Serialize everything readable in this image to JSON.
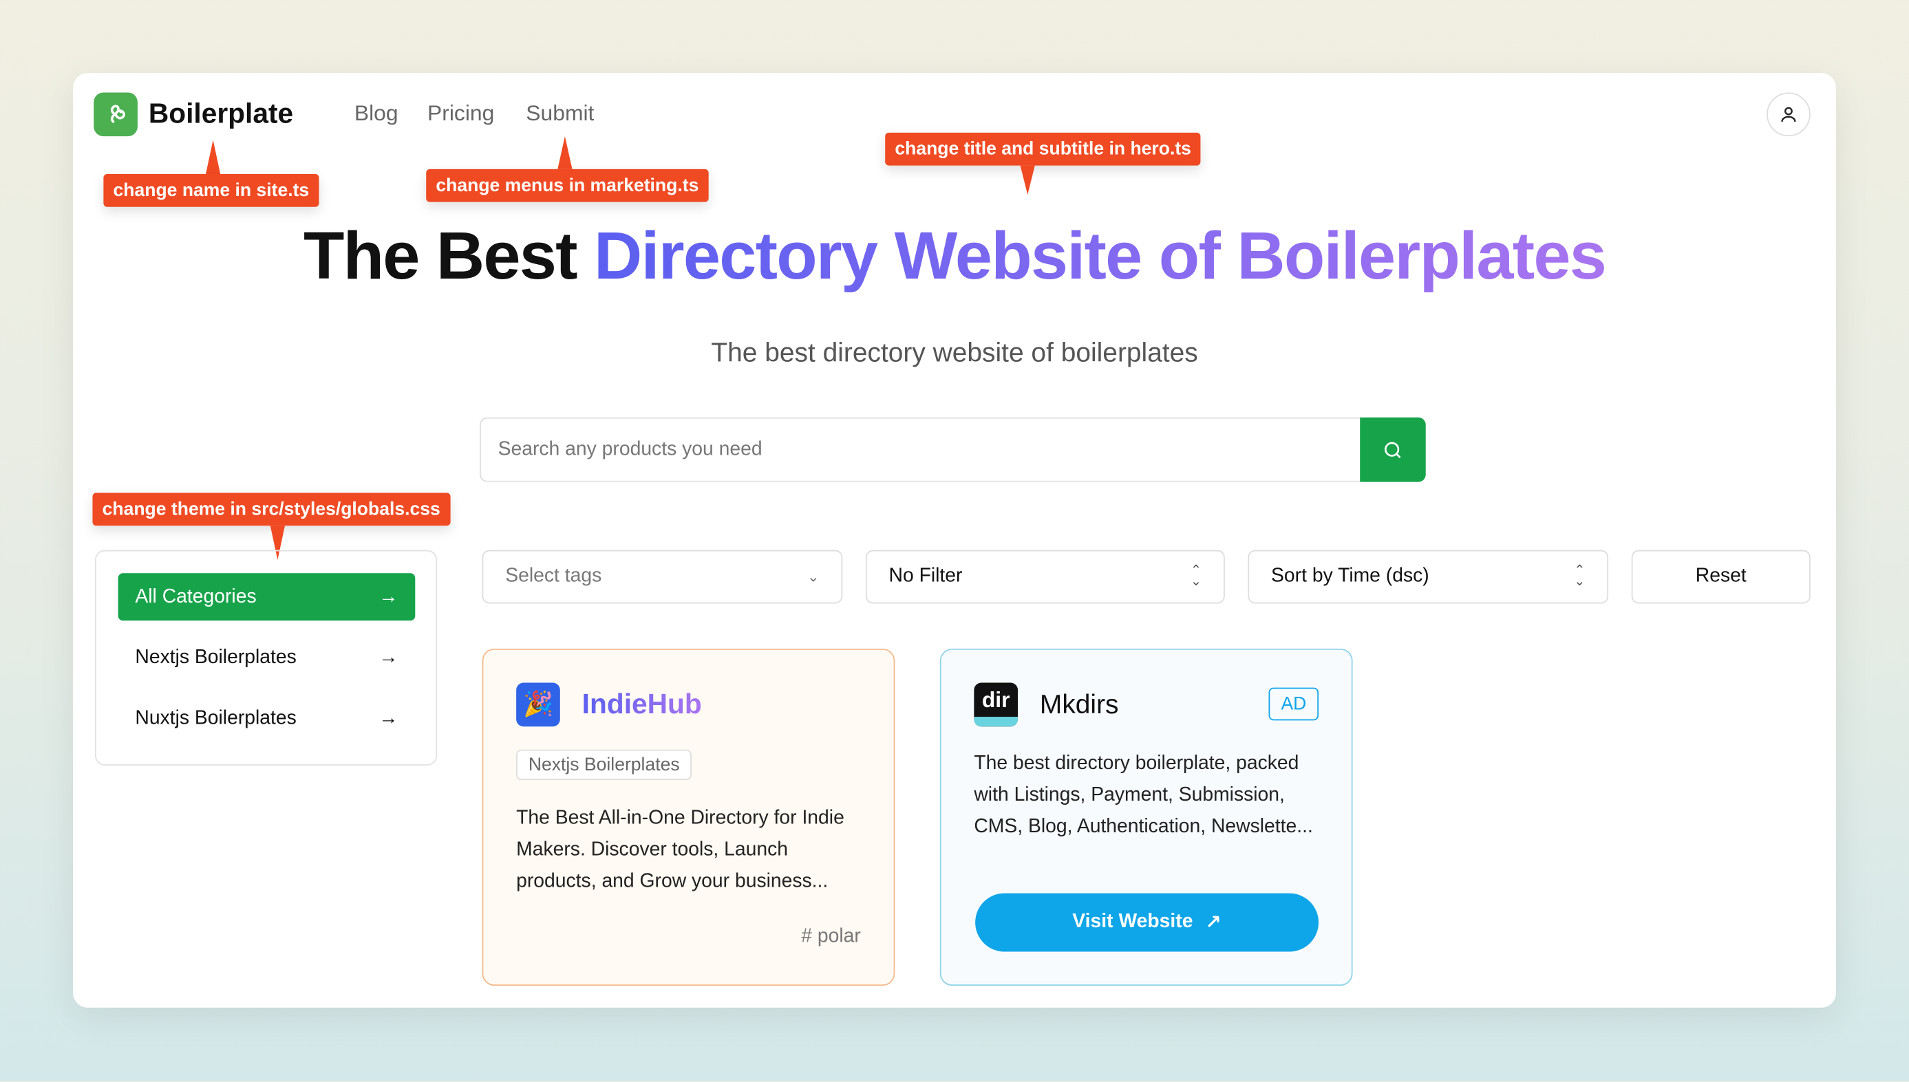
{
  "header": {
    "brand": "Boilerplate",
    "nav": [
      "Blog",
      "Pricing",
      "Submit"
    ]
  },
  "callouts": {
    "name": "change name in site.ts",
    "menus": "change menus in marketing.ts",
    "hero": "change title and subtitle in hero.ts",
    "theme": "change theme in src/styles/globals.css"
  },
  "hero": {
    "title_plain": "The Best ",
    "title_accent": "Directory Website of Boilerplates",
    "subtitle": "The best directory website of boilerplates"
  },
  "search": {
    "placeholder": "Search any products you need"
  },
  "sidebar": {
    "items": [
      {
        "label": "All Categories",
        "active": true
      },
      {
        "label": "Nextjs Boilerplates"
      },
      {
        "label": "Nuxtjs Boilerplates"
      }
    ]
  },
  "filters": {
    "tags": "Select tags",
    "filter": "No Filter",
    "sort": "Sort by Time (dsc)",
    "reset": "Reset"
  },
  "cards": [
    {
      "name": "IndieHub",
      "tag": "Nextjs Boilerplates",
      "description": "The Best All-in-One Directory for Indie Makers. Discover tools, Launch products, and Grow your business...",
      "hashtag": "# polar"
    },
    {
      "name": "Mkdirs",
      "badge": "AD",
      "logo_text": "dir",
      "description": "The best directory boilerplate, packed with Listings, Payment, Submission, CMS, Blog, Authentication, Newslette...",
      "cta": "Visit Website"
    }
  ],
  "colors": {
    "primary": "#16a34a",
    "callout": "#f04a23",
    "visit": "#0ea5e9"
  }
}
